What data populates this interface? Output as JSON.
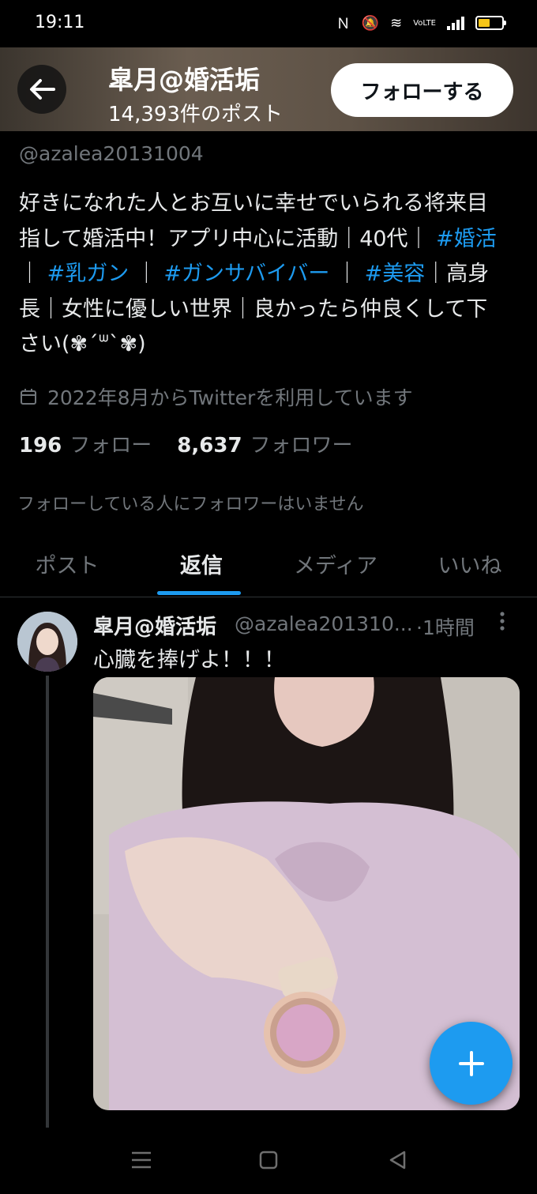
{
  "status_bar": {
    "time": "19:11",
    "network_label": "VoLTE"
  },
  "header": {
    "name": "皐月@婚活垢",
    "post_count": "14,393件のポスト",
    "follow_label": "フォローする"
  },
  "profile": {
    "handle": "@azalea20131004",
    "bio": {
      "line1": "好きになれた人とお互いに幸せでいられる将来目",
      "line2_a": "指して婚活中！アプリ中心に活動｜40代｜",
      "tag1": "#婚活",
      "line3_a": "｜",
      "tag2": "#乳ガン",
      "sep1": "｜",
      "tag3": "#ガンサバイバー",
      "sep2": "｜",
      "tag4": "#美容",
      "line3_b": "｜高身",
      "line4": "長｜女性に優しい世界｜良かったら仲良くして下",
      "line5": "さい(✾´ᐜ`✾)"
    },
    "joined": "2022年8月からTwitterを利用しています",
    "following_count": "196",
    "following_label": "フォロー",
    "followers_count": "8,637",
    "followers_label": "フォロワー",
    "mutual_note": "フォローしている人にフォロワーはいません"
  },
  "tabs": [
    {
      "label": "ポスト",
      "active": false
    },
    {
      "label": "返信",
      "active": true
    },
    {
      "label": "メディア",
      "active": false
    },
    {
      "label": "いいね",
      "active": false
    }
  ],
  "tweet": {
    "name": "皐月@婚活垢",
    "handle": "@azalea201310...",
    "time": "·1時間",
    "text": "心臓を捧げよ！！！"
  },
  "colors": {
    "accent": "#1d9bf0",
    "background": "#000000",
    "muted": "#71767b"
  },
  "icons": {
    "back": "arrow-left-icon",
    "calendar": "calendar-icon",
    "more": "more-vertical-icon",
    "compose": "plus-icon"
  }
}
